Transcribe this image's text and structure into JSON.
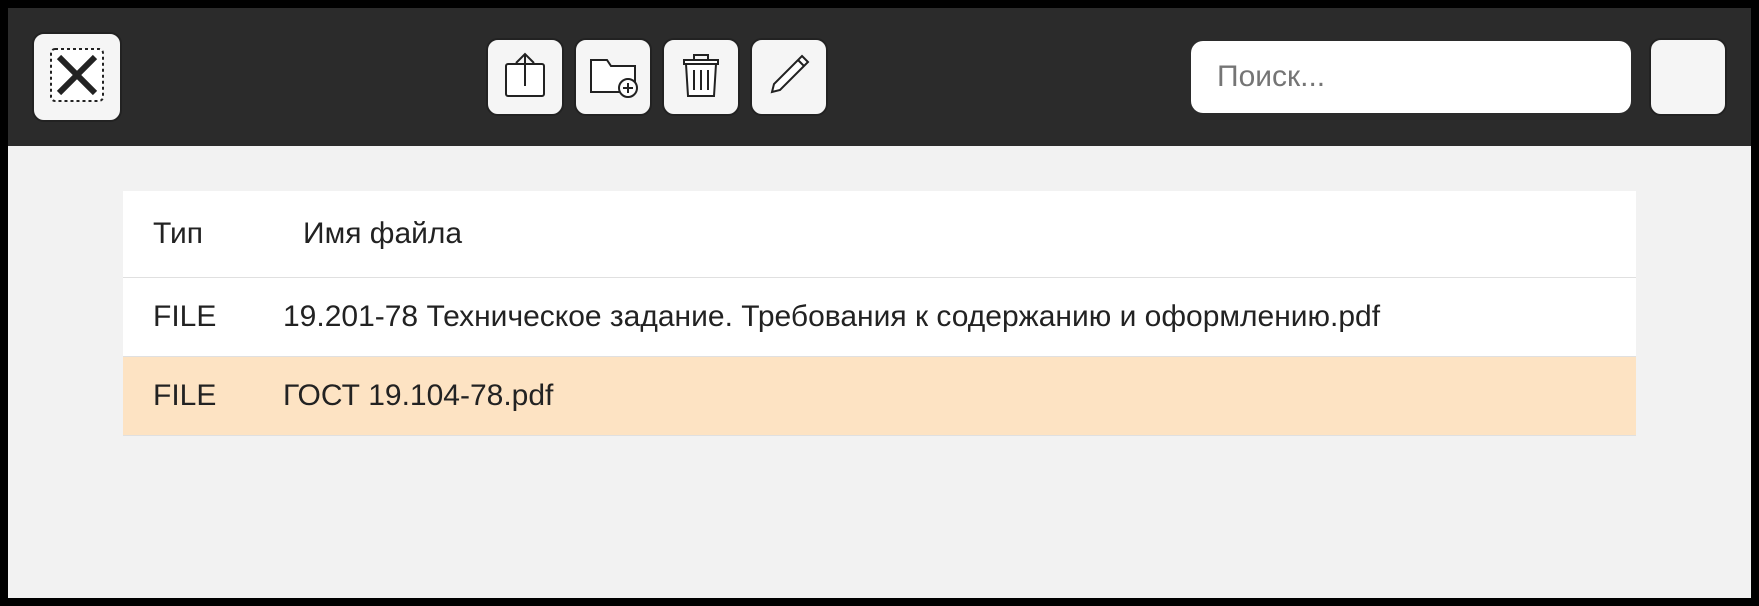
{
  "search": {
    "placeholder": "Поиск..."
  },
  "table": {
    "headers": {
      "type": "Тип",
      "name": "Имя файла"
    },
    "rows": [
      {
        "type": "FILE",
        "name": "19.201-78 Техническое задание. Требования к содержанию и оформлению.pdf",
        "selected": false
      },
      {
        "type": "FILE",
        "name": "ГОСТ 19.104-78.pdf",
        "selected": true
      }
    ]
  }
}
